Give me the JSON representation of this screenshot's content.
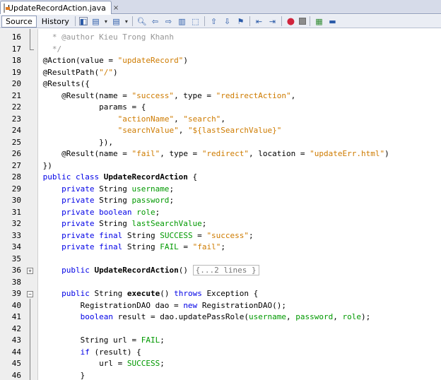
{
  "tab": {
    "filename": "UpdateRecordAction.java",
    "close": "×"
  },
  "toolbar": {
    "source_label": "Source",
    "history_label": "History"
  },
  "editor": {
    "first_line": 16,
    "collapsed_text": "{...2 lines }",
    "lines": [
      {
        "num": "16",
        "tokens": [
          [
            "cm",
            "   * @author Kieu Trong Khanh"
          ]
        ]
      },
      {
        "num": "17",
        "tokens": [
          [
            "cm",
            "   */"
          ]
        ]
      },
      {
        "num": "18",
        "tokens": [
          [
            "plain",
            " @Action(value = "
          ],
          [
            "str",
            "\"updateRecord\""
          ],
          [
            "plain",
            ")"
          ]
        ]
      },
      {
        "num": "19",
        "tokens": [
          [
            "plain",
            " @ResultPath("
          ],
          [
            "str",
            "\"/\""
          ],
          [
            "plain",
            ")"
          ]
        ]
      },
      {
        "num": "20",
        "tokens": [
          [
            "plain",
            " @Results({"
          ]
        ]
      },
      {
        "num": "21",
        "tokens": [
          [
            "plain",
            "     @Result(name = "
          ],
          [
            "str",
            "\"success\""
          ],
          [
            "plain",
            ", type = "
          ],
          [
            "str",
            "\"redirectAction\""
          ],
          [
            "plain",
            ","
          ]
        ]
      },
      {
        "num": "22",
        "tokens": [
          [
            "plain",
            "             params = {"
          ]
        ]
      },
      {
        "num": "23",
        "tokens": [
          [
            "plain",
            "                 "
          ],
          [
            "str",
            "\"actionName\""
          ],
          [
            "plain",
            ", "
          ],
          [
            "str",
            "\"search\""
          ],
          [
            "plain",
            ","
          ]
        ]
      },
      {
        "num": "24",
        "tokens": [
          [
            "plain",
            "                 "
          ],
          [
            "str",
            "\"searchValue\""
          ],
          [
            "plain",
            ", "
          ],
          [
            "str",
            "\"${lastSearchValue}\""
          ]
        ]
      },
      {
        "num": "25",
        "tokens": [
          [
            "plain",
            "             }),"
          ]
        ]
      },
      {
        "num": "26",
        "tokens": [
          [
            "plain",
            "     @Result(name = "
          ],
          [
            "str",
            "\"fail\""
          ],
          [
            "plain",
            ", type = "
          ],
          [
            "str",
            "\"redirect\""
          ],
          [
            "plain",
            ", location = "
          ],
          [
            "str",
            "\"updateErr.html\""
          ],
          [
            "plain",
            ")"
          ]
        ]
      },
      {
        "num": "27",
        "tokens": [
          [
            "plain",
            " })"
          ]
        ]
      },
      {
        "num": "28",
        "tokens": [
          [
            "kw",
            " public class "
          ],
          [
            "bold",
            "UpdateRecordAction"
          ],
          [
            "plain",
            " {"
          ]
        ]
      },
      {
        "num": "29",
        "tokens": [
          [
            "kw",
            "     private "
          ],
          [
            "plain",
            "String "
          ],
          [
            "fld",
            "username"
          ],
          [
            "plain",
            ";"
          ]
        ]
      },
      {
        "num": "30",
        "tokens": [
          [
            "kw",
            "     private "
          ],
          [
            "plain",
            "String "
          ],
          [
            "fld",
            "password"
          ],
          [
            "plain",
            ";"
          ]
        ]
      },
      {
        "num": "31",
        "tokens": [
          [
            "kw",
            "     private boolean "
          ],
          [
            "fld",
            "role"
          ],
          [
            "plain",
            ";"
          ]
        ]
      },
      {
        "num": "32",
        "tokens": [
          [
            "kw",
            "     private "
          ],
          [
            "plain",
            "String "
          ],
          [
            "fld",
            "lastSearchValue"
          ],
          [
            "plain",
            ";"
          ]
        ]
      },
      {
        "num": "33",
        "tokens": [
          [
            "kw",
            "     private final "
          ],
          [
            "plain",
            "String "
          ],
          [
            "fld",
            "SUCCESS"
          ],
          [
            "plain",
            " = "
          ],
          [
            "str",
            "\"success\""
          ],
          [
            "plain",
            ";"
          ]
        ]
      },
      {
        "num": "34",
        "tokens": [
          [
            "kw",
            "     private final "
          ],
          [
            "plain",
            "String "
          ],
          [
            "fld",
            "FAIL"
          ],
          [
            "plain",
            " = "
          ],
          [
            "str",
            "\"fail\""
          ],
          [
            "plain",
            ";"
          ]
        ]
      },
      {
        "num": "35",
        "tokens": []
      },
      {
        "num": "36",
        "tokens": [
          [
            "kw",
            "     public "
          ],
          [
            "bold",
            "UpdateRecordAction"
          ],
          [
            "plain",
            "() "
          ],
          [
            "collapsed",
            "{...2 lines }"
          ]
        ]
      },
      {
        "num": "38",
        "tokens": []
      },
      {
        "num": "39",
        "tokens": [
          [
            "kw",
            "     public "
          ],
          [
            "plain",
            "String "
          ],
          [
            "bold",
            "execute"
          ],
          [
            "plain",
            "() "
          ],
          [
            "kw",
            "throws "
          ],
          [
            "plain",
            "Exception {"
          ]
        ]
      },
      {
        "num": "40",
        "tokens": [
          [
            "plain",
            "         RegistrationDAO dao = "
          ],
          [
            "kw",
            "new "
          ],
          [
            "plain",
            "RegistrationDAO();"
          ]
        ]
      },
      {
        "num": "41",
        "tokens": [
          [
            "kw",
            "         boolean "
          ],
          [
            "plain",
            "result = dao.updatePassRole("
          ],
          [
            "fld",
            "username"
          ],
          [
            "plain",
            ", "
          ],
          [
            "fld",
            "password"
          ],
          [
            "plain",
            ", "
          ],
          [
            "fld",
            "role"
          ],
          [
            "plain",
            ");"
          ]
        ]
      },
      {
        "num": "42",
        "tokens": []
      },
      {
        "num": "43",
        "tokens": [
          [
            "plain",
            "         String url = "
          ],
          [
            "fld",
            "FAIL"
          ],
          [
            "plain",
            ";"
          ]
        ]
      },
      {
        "num": "44",
        "tokens": [
          [
            "kw",
            "         if "
          ],
          [
            "plain",
            "(result) {"
          ]
        ]
      },
      {
        "num": "45",
        "tokens": [
          [
            "plain",
            "             url = "
          ],
          [
            "fld",
            "SUCCESS"
          ],
          [
            "plain",
            ";"
          ]
        ]
      },
      {
        "num": "46",
        "tokens": [
          [
            "plain",
            "         }"
          ]
        ]
      }
    ]
  }
}
